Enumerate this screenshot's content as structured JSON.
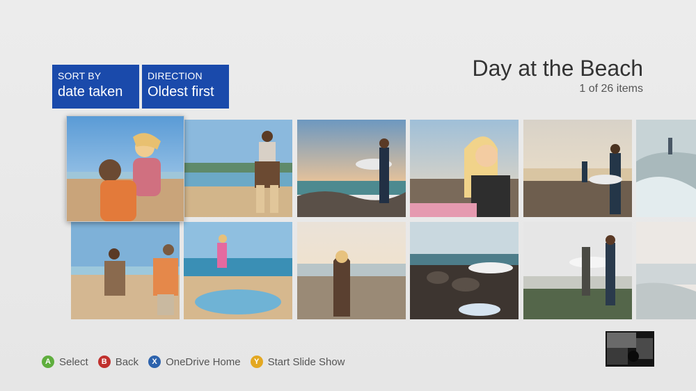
{
  "filters": {
    "sort": {
      "label": "SORT BY",
      "value": "date taken"
    },
    "direction": {
      "label": "DIRECTION",
      "value": "Oldest first"
    }
  },
  "header": {
    "title": "Day at the Beach",
    "count": "1 of 26 items"
  },
  "colors": {
    "filter_bg": "#1a4aab",
    "a": "#5fae3e",
    "b": "#c0302d",
    "x": "#2d63ad",
    "y": "#e3a822"
  },
  "photos": [
    {
      "scene": "couple-piggyback-closeup"
    },
    {
      "scene": "couple-piggyback-wide"
    },
    {
      "scene": "surfer-on-rocks"
    },
    {
      "scene": "smiling-woman"
    },
    {
      "scene": "surfers-walking"
    },
    {
      "scene": "surfer-running-waves"
    },
    {
      "scene": "two-couples-piggyback"
    },
    {
      "scene": "woman-jumping-tidepool"
    },
    {
      "scene": "woman-sunset"
    },
    {
      "scene": "rocks-surfboards"
    },
    {
      "scene": "surfers-pair"
    },
    {
      "scene": "waves-faded"
    }
  ],
  "hints": [
    {
      "key": "A",
      "label": "Select",
      "color": "#5fae3e"
    },
    {
      "key": "B",
      "label": "Back",
      "color": "#c0302d"
    },
    {
      "key": "X",
      "label": "OneDrive Home",
      "color": "#2d63ad"
    },
    {
      "key": "Y",
      "label": "Start Slide Show",
      "color": "#e3a822"
    }
  ]
}
